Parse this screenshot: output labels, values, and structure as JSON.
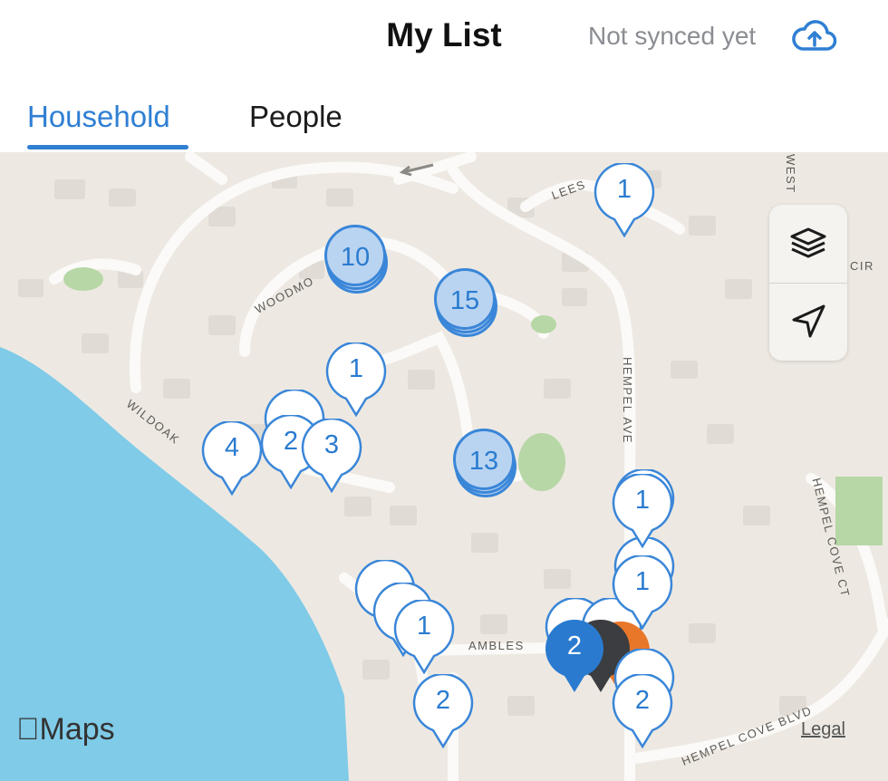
{
  "header": {
    "title": "My List",
    "sync_status": "Not synced yet",
    "upload_icon": "cloud-upload-icon"
  },
  "tabs": [
    {
      "label": "Household",
      "active": true
    },
    {
      "label": "People",
      "active": false
    }
  ],
  "map": {
    "attribution": "Maps",
    "legal_label": "Legal",
    "streets": {
      "lees": "LEES",
      "woodmo": "WOODMO",
      "wildoak": "WILDOAK",
      "hempel_ave": "HEMPEL AVE",
      "hempel_cove_ct": "HEMPEL COVE CT",
      "ambles": "AMBLES",
      "west": "WEST",
      "cir": "CIR",
      "hempel_cove_blvd": "HEMPEL COVE BLVD"
    },
    "clusters": {
      "c1": "10",
      "c2": "15",
      "c3": "13"
    },
    "pins": {
      "p1": "1",
      "p2": "1",
      "p3": "4",
      "p4": "2",
      "p5": "3",
      "p6": "1",
      "p7": "1",
      "p8": "1",
      "p9": "2",
      "p10": "2",
      "p11": "2"
    },
    "controls": {
      "layers_icon": "layers-icon",
      "locate_icon": "location-arrow-icon"
    },
    "colors": {
      "water": "#7fcbe8",
      "land": "#ede9e2",
      "accent": "#2f7fd3",
      "cluster_fill": "#b9d4f1",
      "orange_pin": "#e8772a"
    }
  }
}
